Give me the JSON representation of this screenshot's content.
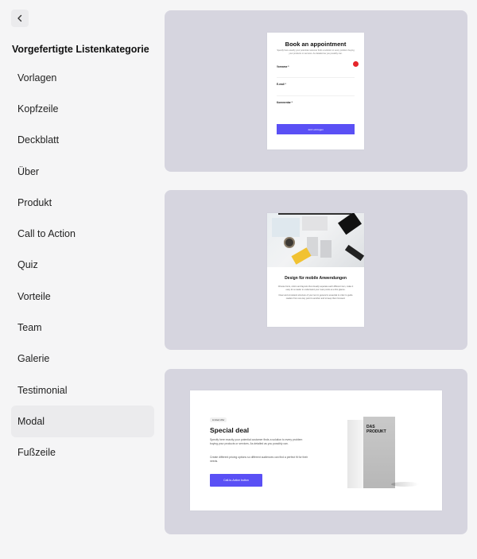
{
  "header": {
    "back_icon": "chevron-left-icon",
    "title": "Vorgefertigte Listenkategorie"
  },
  "sidebar": {
    "items": [
      {
        "label": "Vorlagen",
        "active": false
      },
      {
        "label": "Kopfzeile",
        "active": false
      },
      {
        "label": "Deckblatt",
        "active": false
      },
      {
        "label": "Über",
        "active": false
      },
      {
        "label": "Produkt",
        "active": false
      },
      {
        "label": "Call to Action",
        "active": false
      },
      {
        "label": "Quiz",
        "active": false
      },
      {
        "label": "Vorteile",
        "active": false
      },
      {
        "label": "Team",
        "active": false
      },
      {
        "label": "Galerie",
        "active": false
      },
      {
        "label": "Testimonial",
        "active": false
      },
      {
        "label": "Modal",
        "active": true
      },
      {
        "label": "Fußzeile",
        "active": false
      }
    ]
  },
  "templates": {
    "booking": {
      "title": "Book an appointment",
      "description": "Specify here exactly your potential customer finds a solution to every problem buying your products or services. As detailed as you possibly can.",
      "fields": [
        "Vorname *",
        "E-mail *",
        "Kommentar *"
      ],
      "button": "Jetzt eintragen"
    },
    "mobile": {
      "title": "Design für mobile Anwendungen",
      "text1": "Choose fonts, colors and layouts that visually separate each different item, make it easy for a reader to understand your main points at a first glance.",
      "text2": "Clear and consistent structure of your text in general is essential in order to guide readers from one key point to another and to keep them focused."
    },
    "deal": {
      "badge": "Limited offer",
      "title": "Special deal",
      "text1": "Specify here exactly your potential customer finds a solution to every problem buying your products or services. As detailed as you possibly can.",
      "text2": "Create different pricing options so different audiences can find a perfect fit for their needs.",
      "button": "Call-to-Action button",
      "product_label": "DAS PRODUKT"
    }
  },
  "colors": {
    "accent": "#5a50f5",
    "card_bg": "#d6d5df",
    "page_bg": "#f5f5f6",
    "active_item_bg": "#ebebed",
    "alert_dot": "#e5252a"
  }
}
